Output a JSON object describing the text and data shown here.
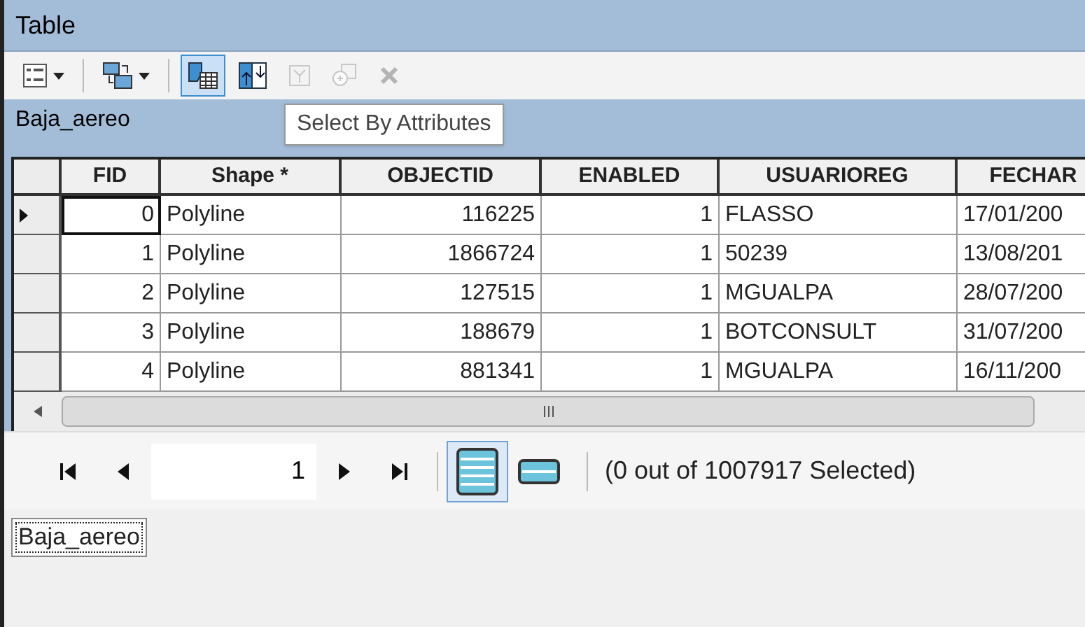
{
  "window": {
    "title": "Table"
  },
  "toolbar": [
    {
      "kind": "options",
      "dropdown": true,
      "disabled": false,
      "selected": false
    },
    {
      "kind": "related",
      "dropdown": true,
      "disabled": false,
      "selected": false
    },
    {
      "kind": "select",
      "dropdown": false,
      "disabled": false,
      "selected": true
    },
    {
      "kind": "switch",
      "dropdown": false,
      "disabled": false,
      "selected": false
    },
    {
      "kind": "clear",
      "dropdown": false,
      "disabled": true,
      "selected": false
    },
    {
      "kind": "zoom",
      "dropdown": false,
      "disabled": true,
      "selected": false
    },
    {
      "kind": "delete",
      "dropdown": false,
      "disabled": true,
      "selected": false
    }
  ],
  "layer_title": "Baja_aereo",
  "tooltip": "Select By Attributes",
  "table": {
    "columns": [
      {
        "label": "FID",
        "kind": "number"
      },
      {
        "label": "Shape *",
        "kind": "text"
      },
      {
        "label": "OBJECTID",
        "kind": "number"
      },
      {
        "label": "ENABLED",
        "kind": "number"
      },
      {
        "label": "USUARIOREG",
        "kind": "text"
      },
      {
        "label": "FECHAR",
        "kind": "text"
      }
    ],
    "rows": [
      {
        "current": true,
        "cells": [
          "0",
          "Polyline",
          "116225",
          "1",
          "FLASSO",
          "17/01/200"
        ]
      },
      {
        "current": false,
        "cells": [
          "1",
          "Polyline",
          "1866724",
          "1",
          "50239",
          "13/08/201"
        ]
      },
      {
        "current": false,
        "cells": [
          "2",
          "Polyline",
          "127515",
          "1",
          "MGUALPA",
          "28/07/200"
        ]
      },
      {
        "current": false,
        "cells": [
          "3",
          "Polyline",
          "188679",
          "1",
          "BOTCONSULT",
          "31/07/200"
        ]
      },
      {
        "current": false,
        "cells": [
          "4",
          "Polyline",
          "881341",
          "1",
          "MGUALPA",
          "16/11/200"
        ]
      }
    ]
  },
  "pager": {
    "record": "1",
    "views": [
      {
        "kind": "all",
        "selected": true
      },
      {
        "kind": "selected",
        "selected": false
      }
    ],
    "status": "(0 out of 1007917 Selected)"
  },
  "tabs": [
    {
      "label": "Baja_aereo",
      "selected": true
    }
  ]
}
